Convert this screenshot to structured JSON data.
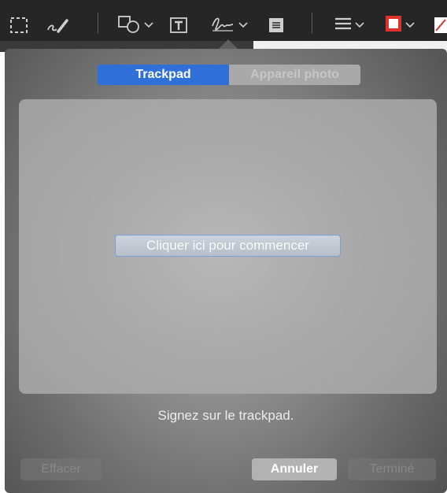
{
  "toolbar": {
    "tools": [
      {
        "icon": "selection-rect-icon"
      },
      {
        "icon": "sketch-icon"
      },
      {
        "icon": "shapes-icon"
      },
      {
        "icon": "text-icon"
      },
      {
        "icon": "sign-icon"
      },
      {
        "icon": "note-icon"
      },
      {
        "icon": "line-style-icon"
      },
      {
        "icon": "border-color-icon",
        "color": "#e0322d"
      },
      {
        "icon": "fill-color-icon",
        "color": "#e0322d"
      }
    ]
  },
  "colors": {
    "accent": "#2f6fd8",
    "border_color": "#e0322d"
  },
  "signature_popover": {
    "tabs": [
      {
        "label": "Trackpad",
        "active": true
      },
      {
        "label": "Appareil photo",
        "active": false
      }
    ],
    "start_button": "Cliquer ici pour commencer",
    "hint": "Signez sur le trackpad.",
    "buttons": {
      "clear": "Effacer",
      "cancel": "Annuler",
      "done": "Terminé"
    }
  }
}
